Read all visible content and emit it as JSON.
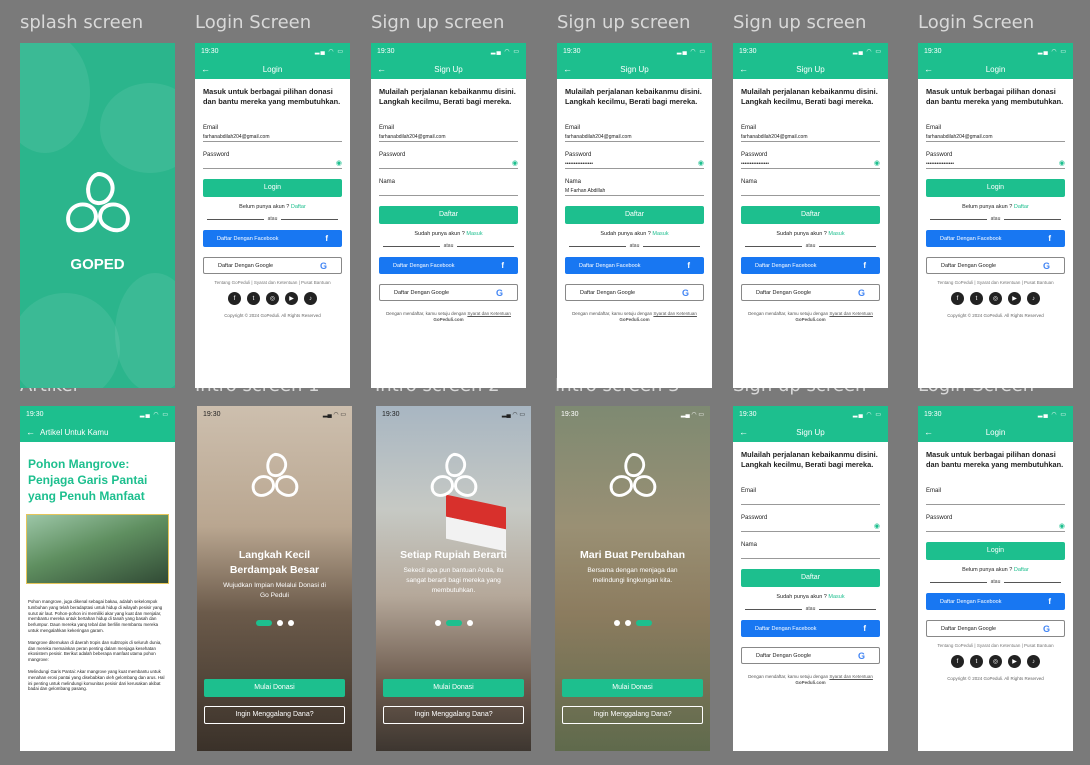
{
  "titles": [
    "splash screen",
    "Login Screen",
    "Sign up screen",
    "Sign up screen",
    "Sign up screen",
    "Login Screen",
    "Artikel",
    "Intro screen 1",
    "Intro screen 2",
    "Intro screen 3",
    "Sign up screen",
    "Login Screen"
  ],
  "status": {
    "time": "19:30",
    "icons": "▂▄ ◠ ▭"
  },
  "brand": "GOPED",
  "login": {
    "title": "Login",
    "headline": "Masuk untuk berbagai pilihan donasi dan bantu mereka yang membutuhkan.",
    "email_label": "Email",
    "email_value": "farhanabdilah204@gmail.com",
    "password_label": "Password",
    "password_value": "••••••••••••••••",
    "login_button": "Login",
    "no_account": "Belum punya akun ?",
    "register_link": "Daftar",
    "or": "atau",
    "facebook": "Daftar Dengan Facebook",
    "google": "Daftar Dengan Google",
    "footer_links": "Tentang GoPeduli | Syarat dan Ketentuan | Pusat Bantuan",
    "copyright": "Copyright © 2024 GoPeduli. All Rights Reserved"
  },
  "signup": {
    "title": "Sign Up",
    "headline": "Mulailah perjalanan kebaikanmu disini. Langkah kecilmu, Berati bagi mereka.",
    "email_label": "Email",
    "email_value": "farhanabdilah204@gmail.com",
    "password_label": "Password",
    "password_value": "••••••••••••••••",
    "name_label": "Nama",
    "name_value": "M Farhan Abdillah",
    "register_button": "Daftar",
    "have_account": "Sudah punya akun ?",
    "login_link": "Masuk",
    "or": "atau",
    "facebook": "Daftar Dengan Facebook",
    "google": "Daftar Dengan Google",
    "terms_prefix": "Dengan mendaftar, kamu setuju dengan",
    "terms_link": "Syarat dan Ketentuan",
    "terms_suffix": "GoPeduli.com"
  },
  "article": {
    "nav_title": "Artikel Untuk Kamu",
    "title": "Pohon Mangrove: Penjaga Garis Pantai yang Penuh Manfaat",
    "p1": "Pohon mangrove, juga dikenal sebagai bakau, adalah sekelompok tumbuhan yang telah beradaptasi untuk hidup di wilayah pesisir yang surut air laut. Pohon-pohon ini memiliki akar yang kuat dan menjalar, membantu mereka untuk bertahan hidup di tanah yang basah dan berlumpur. Daun mereka yang tebal dan berlilin membantu mereka untuk mengalahkan kekeringan garam.",
    "p2": "Mangrove ditemukan di daerah tropis dan subtropis di seluruh dunia, dan mereka memainkan peran penting dalam menjaga kesehatan ekosistem pesisir. Berikut adalah beberapa manfaat utama pohon mangrove:",
    "p3": "Melindungi Garis Pantai: Akar mangrove yang kuat membantu untuk menahan erosi pantai yang disebabkan oleh gelombang dan arus. Hal ini penting untuk melindungi komunitas pesisir dari kerusakan akibat badai dan gelombang pasang."
  },
  "intro": [
    {
      "title": "Langkah Kecil Berdampak Besar",
      "text": "Wujudkan Impian Melalui Donasi di Go Peduli",
      "active": 0
    },
    {
      "title": "Setiap Rupiah Berarti",
      "text": "Sekecil apa pun bantuan Anda, itu sangat berarti bagi mereka yang membutuhkan.",
      "active": 1
    },
    {
      "title": "Mari Buat Perubahan",
      "text": "Bersama dengan menjaga dan melindungi lingkungan kita.",
      "active": 2
    }
  ],
  "intro_buttons": {
    "primary": "Mulai Donasi",
    "secondary": "Ingin Menggalang Dana?"
  },
  "social_icons": [
    "facebook-icon",
    "twitter-icon",
    "instagram-icon",
    "youtube-icon",
    "tiktok-icon"
  ],
  "colors": {
    "primary": "#1dbf8e",
    "facebook": "#1877f2",
    "canvas": "#7a7a7a"
  }
}
